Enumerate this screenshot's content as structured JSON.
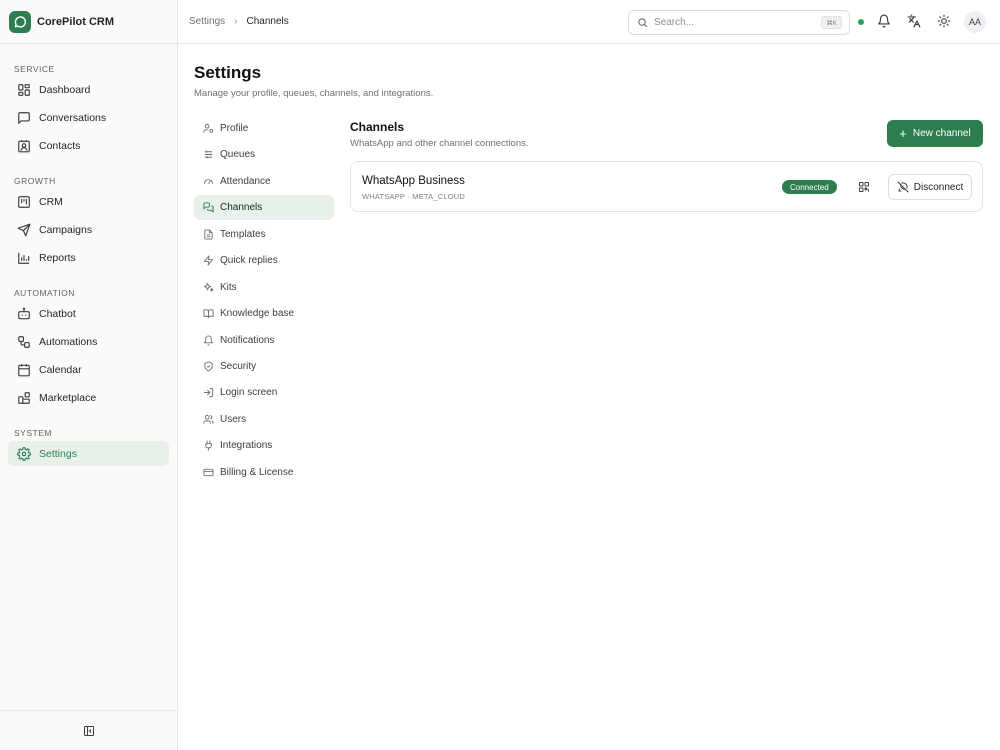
{
  "app": {
    "name": "CorePilot CRM"
  },
  "sidebar": {
    "sections": [
      {
        "heading": "SERVICE",
        "items": [
          {
            "label": "Dashboard",
            "icon": "grid-icon"
          },
          {
            "label": "Conversations",
            "icon": "message-square-icon"
          },
          {
            "label": "Contacts",
            "icon": "contact-icon"
          }
        ]
      },
      {
        "heading": "GROWTH",
        "items": [
          {
            "label": "CRM",
            "icon": "kanban-icon"
          },
          {
            "label": "Campaigns",
            "icon": "send-icon"
          },
          {
            "label": "Reports",
            "icon": "bar-chart-icon"
          }
        ]
      },
      {
        "heading": "AUTOMATION",
        "items": [
          {
            "label": "Chatbot",
            "icon": "bot-icon"
          },
          {
            "label": "Automations",
            "icon": "workflow-icon"
          },
          {
            "label": "Calendar",
            "icon": "calendar-icon"
          },
          {
            "label": "Marketplace",
            "icon": "blocks-icon"
          }
        ]
      },
      {
        "heading": "SYSTEM",
        "items": [
          {
            "label": "Settings",
            "icon": "gear-icon",
            "active": true
          }
        ]
      }
    ]
  },
  "topbar": {
    "breadcrumb": [
      "Settings",
      "Channels"
    ],
    "search_placeholder": "Search...",
    "search_shortcut": "⌘K",
    "avatar_initials": "AA"
  },
  "page": {
    "title": "Settings",
    "subtitle": "Manage your profile, queues, channels, and integrations."
  },
  "settings_menu": [
    {
      "label": "Profile",
      "icon": "user-cog-icon"
    },
    {
      "label": "Queues",
      "icon": "sliders-icon"
    },
    {
      "label": "Attendance",
      "icon": "gauge-icon"
    },
    {
      "label": "Channels",
      "icon": "messages-icon",
      "active": true
    },
    {
      "label": "Templates",
      "icon": "file-text-icon"
    },
    {
      "label": "Quick replies",
      "icon": "zap-icon"
    },
    {
      "label": "Kits",
      "icon": "sparkles-icon"
    },
    {
      "label": "Knowledge base",
      "icon": "book-icon"
    },
    {
      "label": "Notifications",
      "icon": "bell-icon"
    },
    {
      "label": "Security",
      "icon": "shield-icon"
    },
    {
      "label": "Login screen",
      "icon": "log-in-icon"
    },
    {
      "label": "Users",
      "icon": "users-icon"
    },
    {
      "label": "Integrations",
      "icon": "plug-icon"
    },
    {
      "label": "Billing & License",
      "icon": "credit-card-icon"
    }
  ],
  "channels": {
    "title": "Channels",
    "subtitle": "WhatsApp and other channel connections.",
    "new_button": "New channel",
    "items": [
      {
        "name": "WhatsApp Business",
        "meta": "WHATSAPP · META_CLOUD",
        "status": "Connected",
        "disconnect_label": "Disconnect"
      }
    ]
  },
  "colors": {
    "accent": "#2e7d4f",
    "accent_soft": "#e7f1ea",
    "status_online": "#2e9e5b"
  }
}
